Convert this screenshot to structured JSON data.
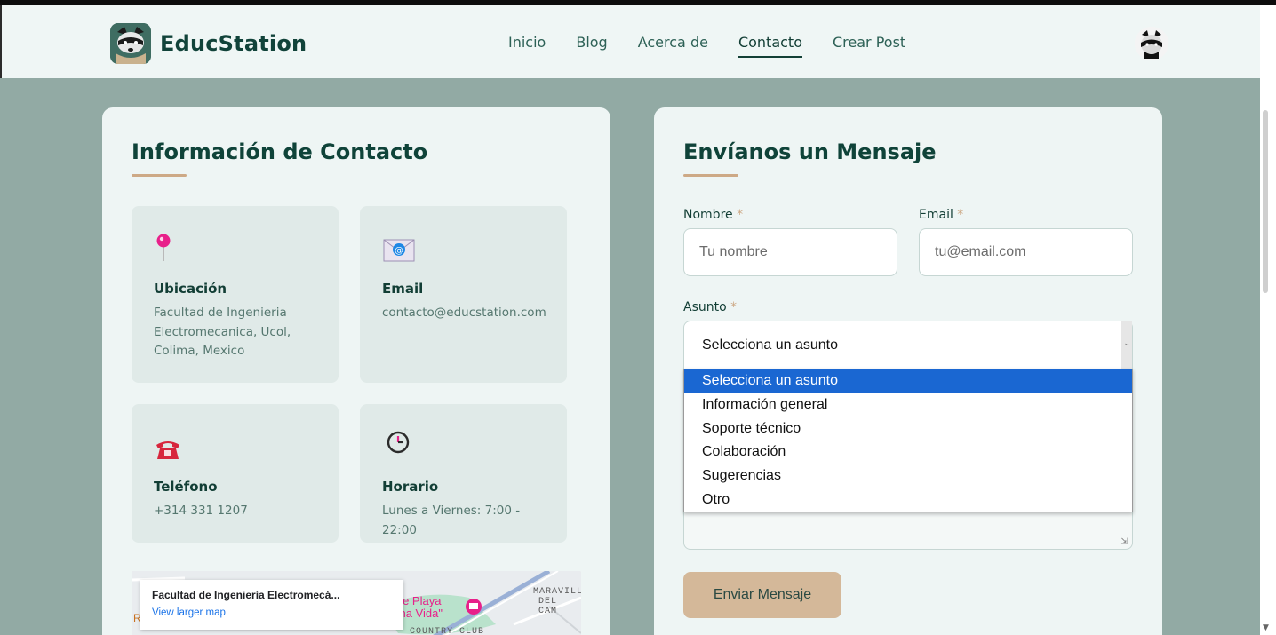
{
  "brand": {
    "name": "EducStation"
  },
  "nav": {
    "items": [
      {
        "label": "Inicio"
      },
      {
        "label": "Blog"
      },
      {
        "label": "Acerca de"
      },
      {
        "label": "Contacto"
      },
      {
        "label": "Crear Post"
      }
    ],
    "active": "Contacto"
  },
  "contact_info": {
    "title": "Información de Contacto",
    "cards": [
      {
        "icon": "map-pin-icon",
        "title": "Ubicación",
        "text": "Facultad de Ingenieria Electromecanica, Ucol, Colima, Mexico"
      },
      {
        "icon": "envelope-icon",
        "title": "Email",
        "text": "contacto@educstation.com"
      },
      {
        "icon": "telephone-icon",
        "title": "Teléfono",
        "text": "+314 331 1207"
      },
      {
        "icon": "clock-icon",
        "title": "Horario",
        "text": "Lunes a Viernes: 7:00 - 22:00"
      }
    ],
    "map": {
      "place": "Facultad de Ingeniería Electromecá...",
      "link": "View larger map",
      "labels": [
        "a de Playa",
        "uena Vida\"",
        "MARAVILL",
        "DEL CAM",
        "COUNTRY CLUB",
        "R"
      ]
    }
  },
  "form": {
    "title": "Envíanos un Mensaje",
    "name_label": "Nombre",
    "name_placeholder": "Tu nombre",
    "email_label": "Email",
    "email_placeholder": "tu@email.com",
    "subject_label": "Asunto",
    "required_mark": "*",
    "subject_value": "Selecciona un asunto",
    "subject_options": [
      "Selecciona un asunto",
      "Información general",
      "Soporte técnico",
      "Colaboración",
      "Sugerencias",
      "Otro"
    ],
    "submit_label": "Enviar Mensaje"
  },
  "colors": {
    "page_bg": "#92aaa4",
    "card_bg": "#eef5f4",
    "primary_text": "#0f4339",
    "accent": "#cda986",
    "button": "#d4b899",
    "selected_option": "#1a67d2"
  }
}
